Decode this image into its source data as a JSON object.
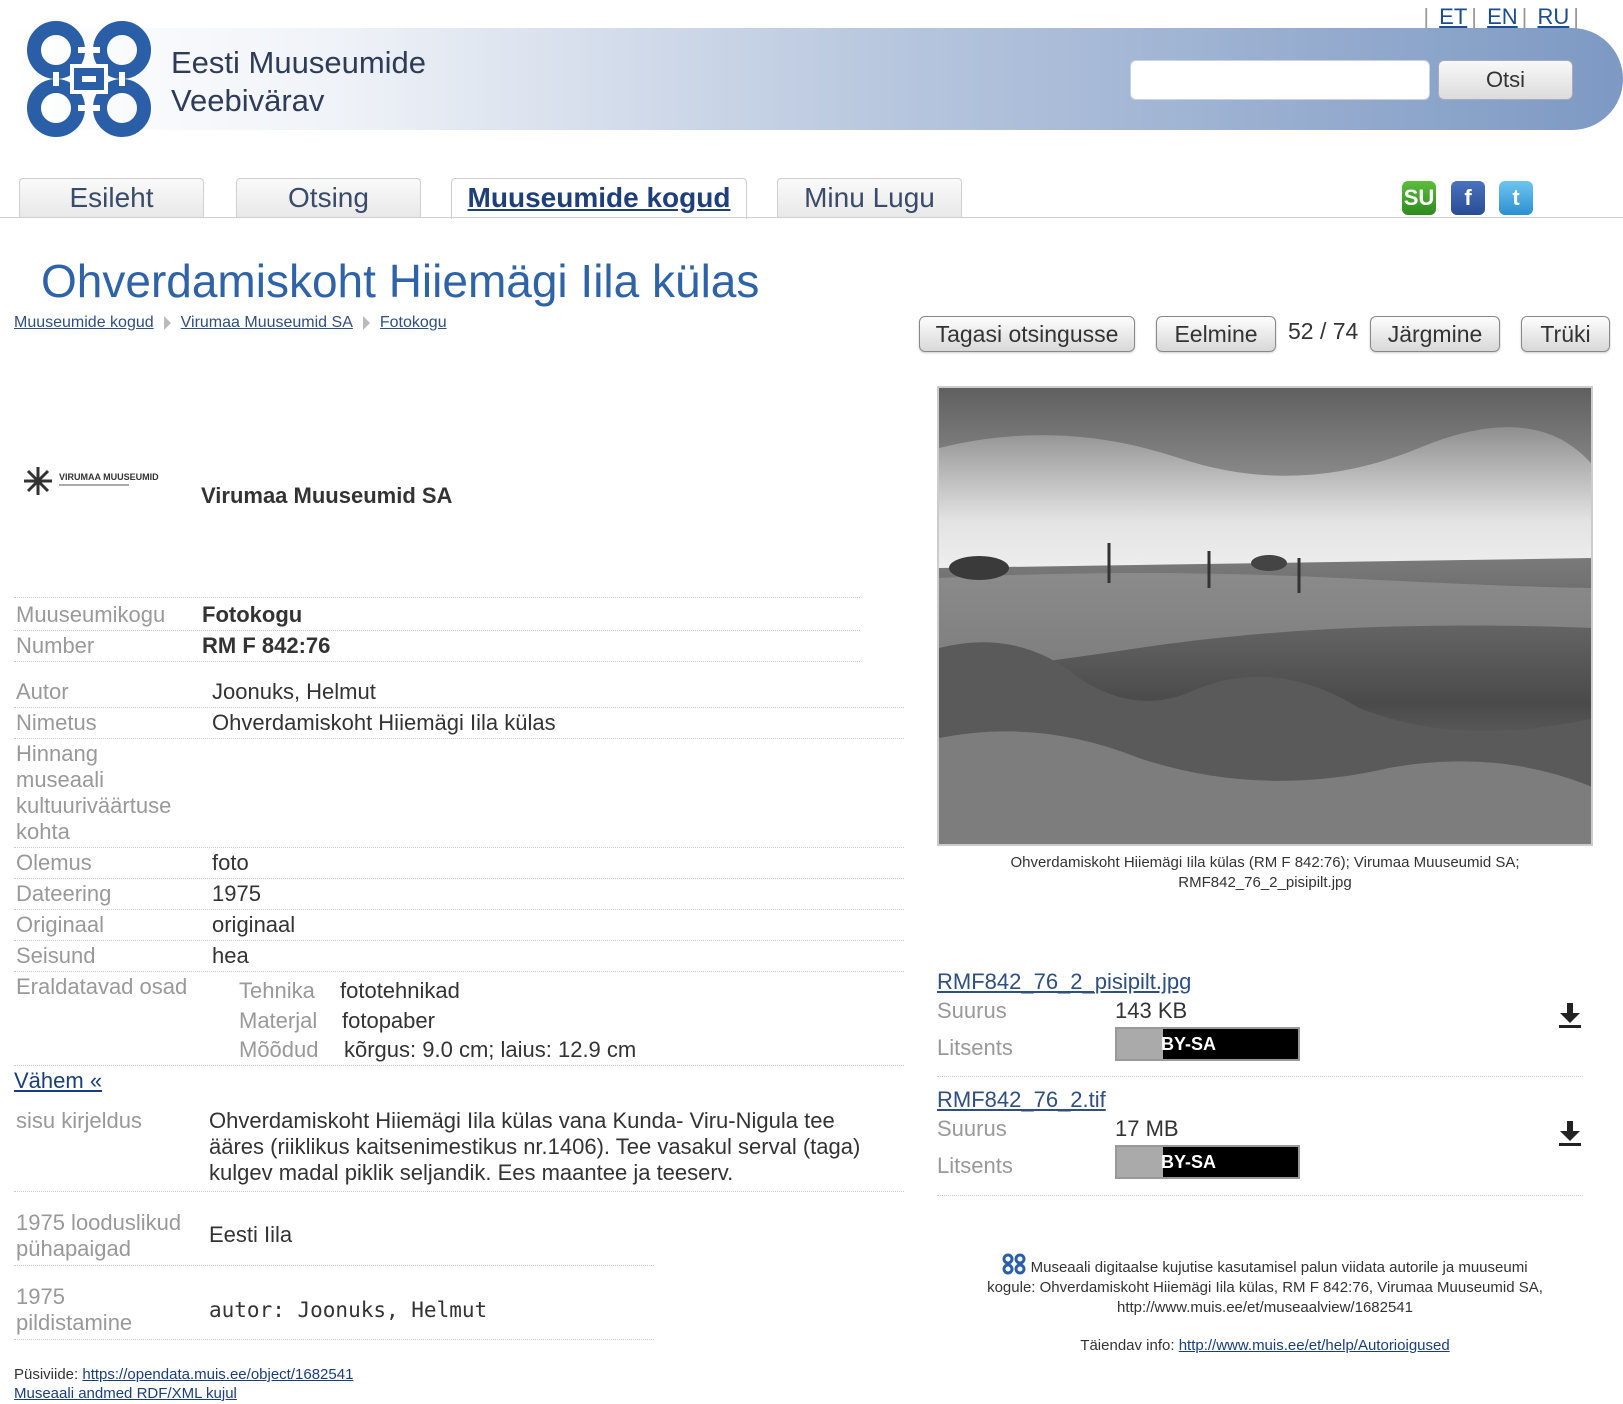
{
  "languages": [
    "ET",
    "EN",
    "RU"
  ],
  "site": {
    "title_line1": "Eesti Muuseumide",
    "title_line2": "Veebivärav"
  },
  "search": {
    "button": "Otsi",
    "placeholder": ""
  },
  "tabs": [
    {
      "label": "Esileht"
    },
    {
      "label": "Otsing"
    },
    {
      "label": "Muuseumide kogud",
      "active": true
    },
    {
      "label": "Minu Lugu"
    }
  ],
  "social": [
    "stumbleupon-icon",
    "facebook-icon",
    "twitter-icon"
  ],
  "page_title": "Ohverdamiskoht Hiiemägi Iila külas",
  "breadcrumb": [
    "Muuseumide kogud",
    "Virumaa Muuseumid SA",
    "Fotokogu"
  ],
  "nav": {
    "back": "Tagasi otsingusse",
    "prev": "Eelmine",
    "counter": "52 / 74",
    "next": "Järgmine",
    "print": "Trüki"
  },
  "museum": {
    "logo_text": "VIRUMAA MUUSEUMID",
    "name": "Virumaa Muuseumid SA"
  },
  "fields_top": [
    {
      "label": "Muuseumikogu",
      "value": "Fotokogu"
    },
    {
      "label": "Number",
      "value": "RM F 842:76"
    }
  ],
  "fields": [
    {
      "label": "Autor",
      "value": "Joonuks, Helmut"
    },
    {
      "label": "Nimetus",
      "value": "Ohverdamiskoht Hiiemägi Iila külas"
    },
    {
      "label": "Hinnang museaali kultuuriväärtuse kohta",
      "value": ""
    },
    {
      "label": "Olemus",
      "value": "foto"
    },
    {
      "label": "Dateering",
      "value": "1975"
    },
    {
      "label": "Originaal",
      "value": "originaal"
    },
    {
      "label": "Seisund",
      "value": "hea"
    }
  ],
  "detachable": {
    "label": "Eraldatavad osad",
    "items": [
      {
        "label": "Tehnika",
        "value": "fototehnikad"
      },
      {
        "label": "Materjal",
        "value": "fotopaber"
      },
      {
        "label": "Mõõdud",
        "value": "kõrgus: 9.0 cm; laius: 12.9 cm"
      }
    ]
  },
  "less_link": "Vähem «",
  "description": {
    "label": "sisu kirjeldus",
    "lines": [
      "Ohverdamiskoht Hiiemägi Iila külas vana Kunda- Viru-Nigula tee",
      "ääres (riiklikus kaitsenimestikus nr.1406). Tee vasakul serval (taga)",
      "kulgev madal piklik seljandik. Ees maantee ja teeserv."
    ]
  },
  "extra_fields": [
    {
      "label_line1": "1975 looduslikud",
      "label_line2": "pühapaigad",
      "value": "Eesti Iila"
    },
    {
      "label_line1": "1975",
      "label_line2": "pildistamine",
      "value": "autor: Joonuks, Helmut"
    }
  ],
  "footer": {
    "permalink_label": "Püsiviide:",
    "permalink": "https://opendata.muis.ee/object/1682541",
    "rdf": "Museaali andmed RDF/XML kujul"
  },
  "image_caption": {
    "line1": "Ohverdamiskoht Hiiemägi Iila külas (RM F 842:76); Virumaa Muuseumid SA;",
    "line2": "RMF842_76_2_pisipilt.jpg"
  },
  "files": [
    {
      "name": "RMF842_76_2_pisipilt.jpg",
      "size_label": "Suurus",
      "size": "143 KB",
      "license_label": "Litsents",
      "license": "BY-SA"
    },
    {
      "name": "RMF842_76_2.tif",
      "size_label": "Suurus",
      "size": "17 MB",
      "license_label": "Litsents",
      "license": "BY-SA"
    }
  ],
  "usage_note": {
    "line1": "Museaali digitaalse kujutise kasutamisel palun viidata autorile ja muuseumi",
    "line2": "kogule: Ohverdamiskoht Hiiemägi Iila külas, RM F 842:76, Virumaa Muuseumid SA,",
    "line3": "http://www.muis.ee/et/museaalview/1682541"
  },
  "extra_info": {
    "label": "Täiendav info:",
    "link": "http://www.muis.ee/et/help/Autorioigused"
  },
  "colors": {
    "title": "#2f63a8",
    "header_gradient_end": "#7d99c3"
  }
}
